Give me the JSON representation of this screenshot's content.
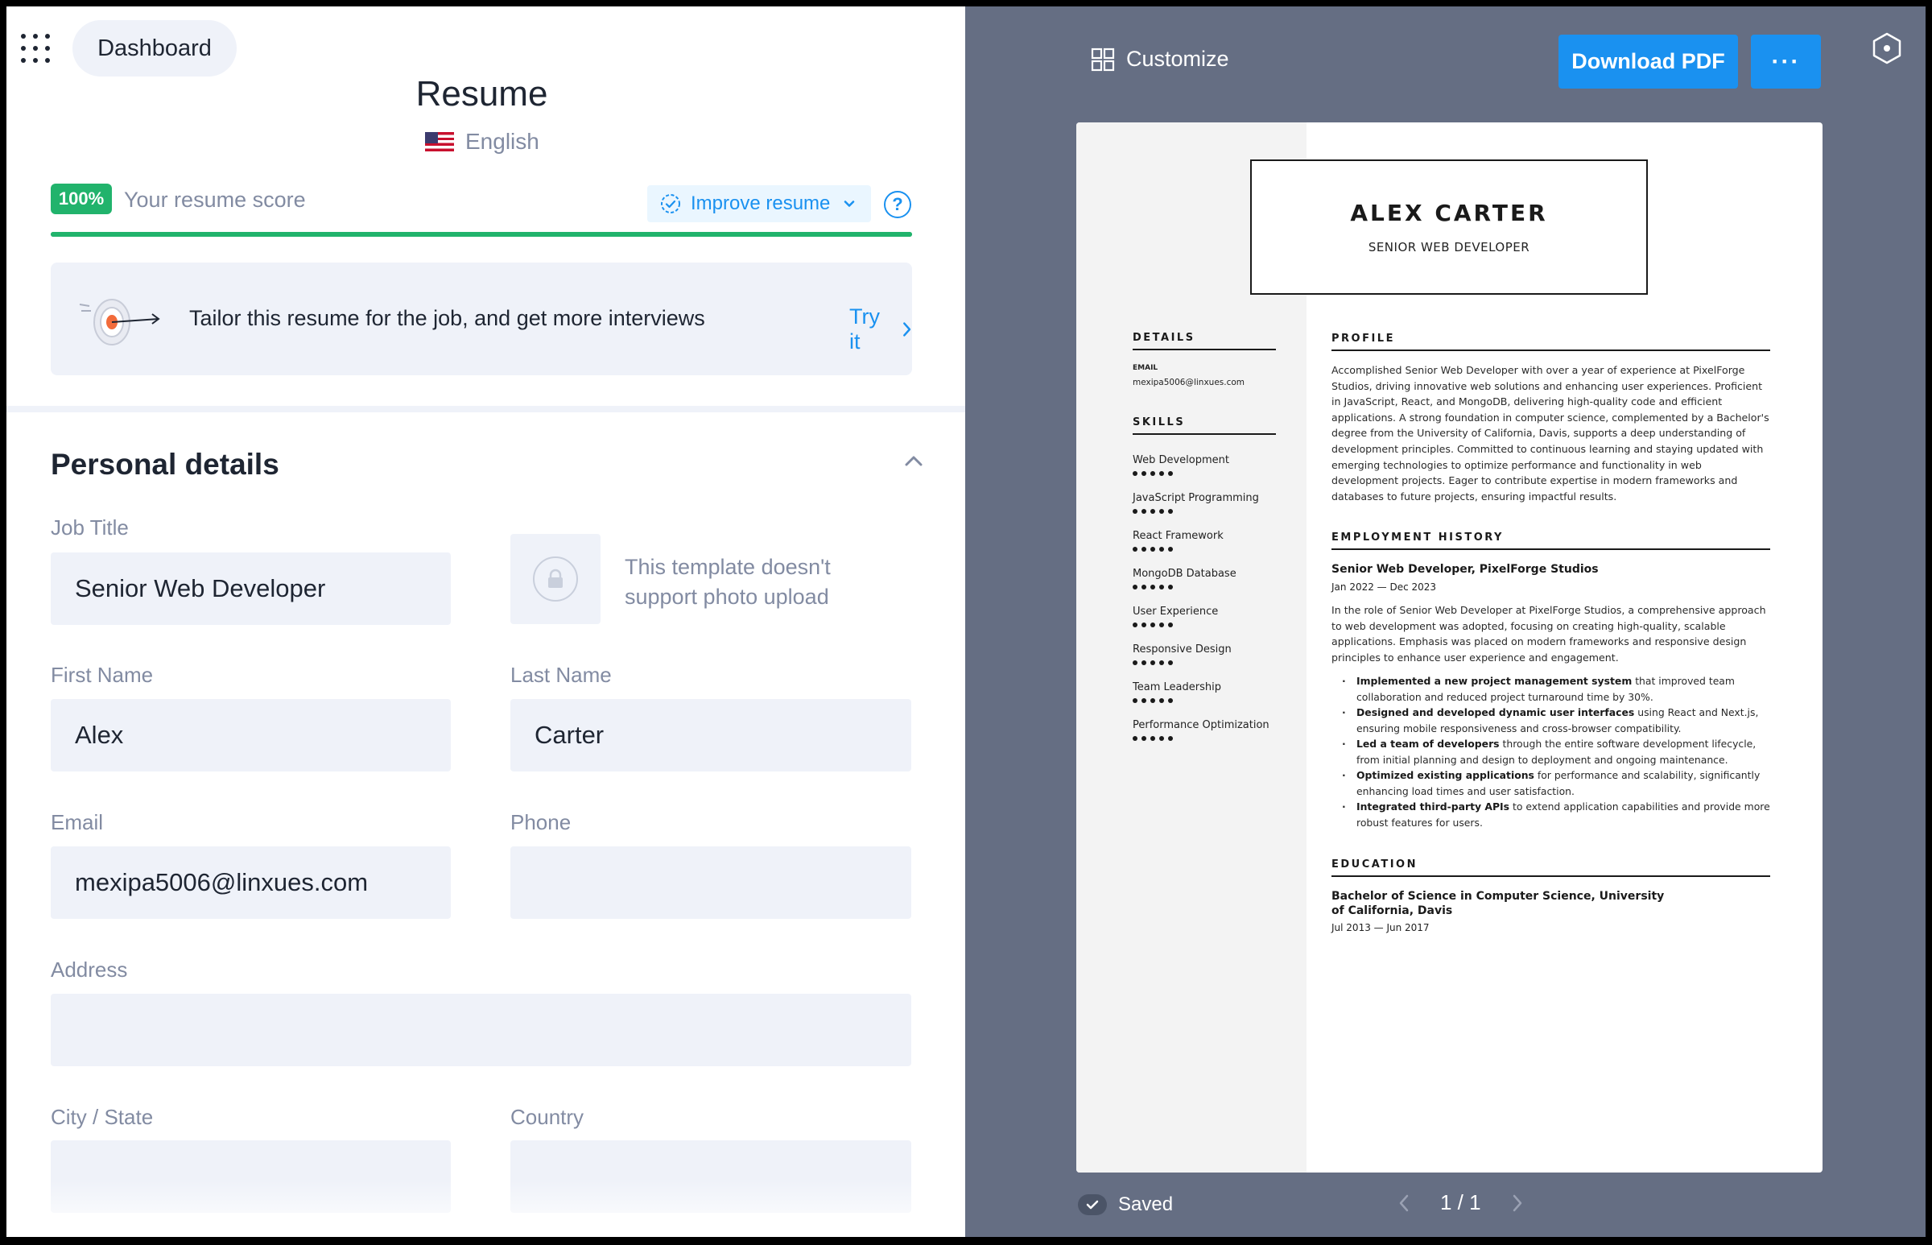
{
  "topbar": {
    "dashboard_label": "Dashboard"
  },
  "document": {
    "title": "Resume",
    "language": "English"
  },
  "score": {
    "badge": "100%",
    "label": "Your resume score",
    "percent": 100,
    "improve_label": "Improve resume",
    "help_label": "?"
  },
  "tailor": {
    "text": "Tailor this resume for the job, and get more interviews",
    "action": "Try it"
  },
  "personal_details": {
    "section_title": "Personal details",
    "job_title": {
      "label": "Job Title",
      "value": "Senior Web Developer"
    },
    "photo_note": "This template doesn't support photo upload",
    "first_name": {
      "label": "First Name",
      "value": "Alex"
    },
    "last_name": {
      "label": "Last Name",
      "value": "Carter"
    },
    "email": {
      "label": "Email",
      "value": "mexipa5006@linxues.com"
    },
    "phone": {
      "label": "Phone",
      "value": ""
    },
    "address": {
      "label": "Address",
      "value": ""
    },
    "city_state": {
      "label": "City / State",
      "value": ""
    },
    "country": {
      "label": "Country",
      "value": ""
    }
  },
  "preview_toolbar": {
    "customize_label": "Customize",
    "download_label": "Download PDF",
    "more_label": "···"
  },
  "resume": {
    "name": "ALEX CARTER",
    "role": "SENIOR WEB DEVELOPER",
    "details_heading": "DETAILS",
    "email_label": "EMAIL",
    "email": "mexipa5006@linxues.com",
    "skills_heading": "SKILLS",
    "skills": [
      {
        "name": "Web Development",
        "level": 5
      },
      {
        "name": "JavaScript Programming",
        "level": 5
      },
      {
        "name": "React Framework",
        "level": 5
      },
      {
        "name": "MongoDB Database",
        "level": 5
      },
      {
        "name": "User Experience",
        "level": 5
      },
      {
        "name": "Responsive Design",
        "level": 5
      },
      {
        "name": "Team Leadership",
        "level": 5
      },
      {
        "name": "Performance Optimization",
        "level": 5
      }
    ],
    "profile_heading": "PROFILE",
    "profile": "Accomplished Senior Web Developer with over a year of experience at PixelForge Studios, driving innovative web solutions and enhancing user experiences. Proficient in JavaScript, React, and MongoDB, delivering high-quality code and efficient applications. A strong foundation in computer science, complemented by a Bachelor's degree from the University of California, Davis, supports a deep understanding of development principles. Committed to continuous learning and staying updated with emerging technologies to optimize performance and functionality in web development projects. Eager to contribute expertise in modern frameworks and databases to future projects, ensuring impactful results.",
    "employment_heading": "EMPLOYMENT HISTORY",
    "job": {
      "title": "Senior Web Developer, PixelForge Studios",
      "dates": "Jan 2022 — Dec 2023",
      "summary": "In the role of Senior Web Developer at PixelForge Studios, a comprehensive approach to web development was adopted, focusing on creating high-quality, scalable applications. Emphasis was placed on modern frameworks and responsive design principles to enhance user experience and engagement.",
      "bullets": [
        {
          "bold": "Implemented a new project management system",
          "rest": " that improved team collaboration and reduced project turnaround time by 30%."
        },
        {
          "bold": "Designed and developed dynamic user interfaces",
          "rest": " using React and Next.js, ensuring mobile responsiveness and cross-browser compatibility."
        },
        {
          "bold": "Led a team of developers",
          "rest": " through the entire software development lifecycle, from initial planning and design to deployment and ongoing maintenance."
        },
        {
          "bold": "Optimized existing applications",
          "rest": " for performance and scalability, significantly enhancing load times and user satisfaction."
        },
        {
          "bold": "Integrated third-party APIs",
          "rest": " to extend application capabilities and provide more robust features for users."
        }
      ]
    },
    "education_heading": "EDUCATION",
    "education": {
      "degree_line1": "Bachelor of Science in Computer Science, University",
      "degree_line2": "of California, Davis",
      "dates": "Jul 2013 — Jun 2017"
    }
  },
  "footer": {
    "saved_label": "Saved",
    "page_indicator": "1 / 1"
  },
  "colors": {
    "accent": "#1a91f0",
    "success": "#21b36c",
    "preview_bg": "#656e83",
    "field_bg": "#eff2f9"
  },
  "icons": [
    "apps-grid-icon",
    "chevron-down-icon",
    "help-icon",
    "target-icon",
    "chevron-right-icon",
    "chevron-up-icon",
    "lock-icon",
    "grid-icon",
    "hexagon-icon",
    "check-icon",
    "chevron-left-icon"
  ]
}
